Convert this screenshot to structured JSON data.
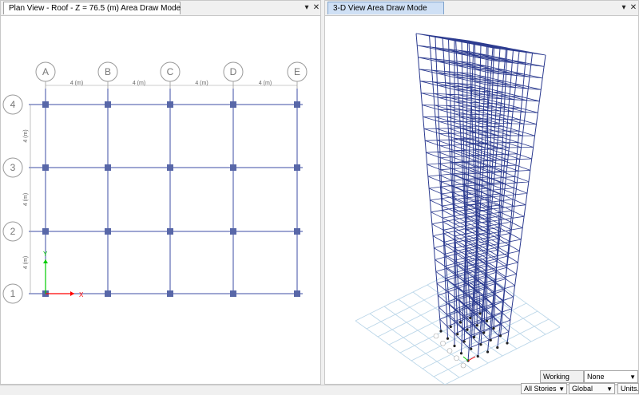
{
  "left_panel": {
    "tab_title": "Plan View - Roof - Z = 76.5 (m)  Area Draw Mode",
    "dropdown_glyph": "▾",
    "close_glyph": "✕",
    "grid": {
      "columns": [
        "A",
        "B",
        "C",
        "D",
        "E"
      ],
      "rows": [
        "1",
        "2",
        "3",
        "4"
      ],
      "x_spacing_label": "4 (m)",
      "y_spacing_label": "4 (m)"
    },
    "axis_x_label": "X",
    "axis_y_label": "Y"
  },
  "right_panel": {
    "tab_title": "3-D View  Area Draw Mode",
    "dropdown_glyph": "▾",
    "close_glyph": "✕",
    "stories": 25,
    "bays": 4
  },
  "colors": {
    "grid_line": "#3c4ea6",
    "column_marker": "#5867a8",
    "bubble": "#9a9a9a",
    "frame": "#2b3a8f",
    "ground_grid": "#b9d5e8",
    "axis_x": "#ff0000",
    "axis_y": "#00cc00"
  },
  "working_plane": {
    "label": "Working Plane",
    "value": "None"
  },
  "status_bar": {
    "stories": "All Stories",
    "coord_system": "Global",
    "units": "Units..."
  }
}
